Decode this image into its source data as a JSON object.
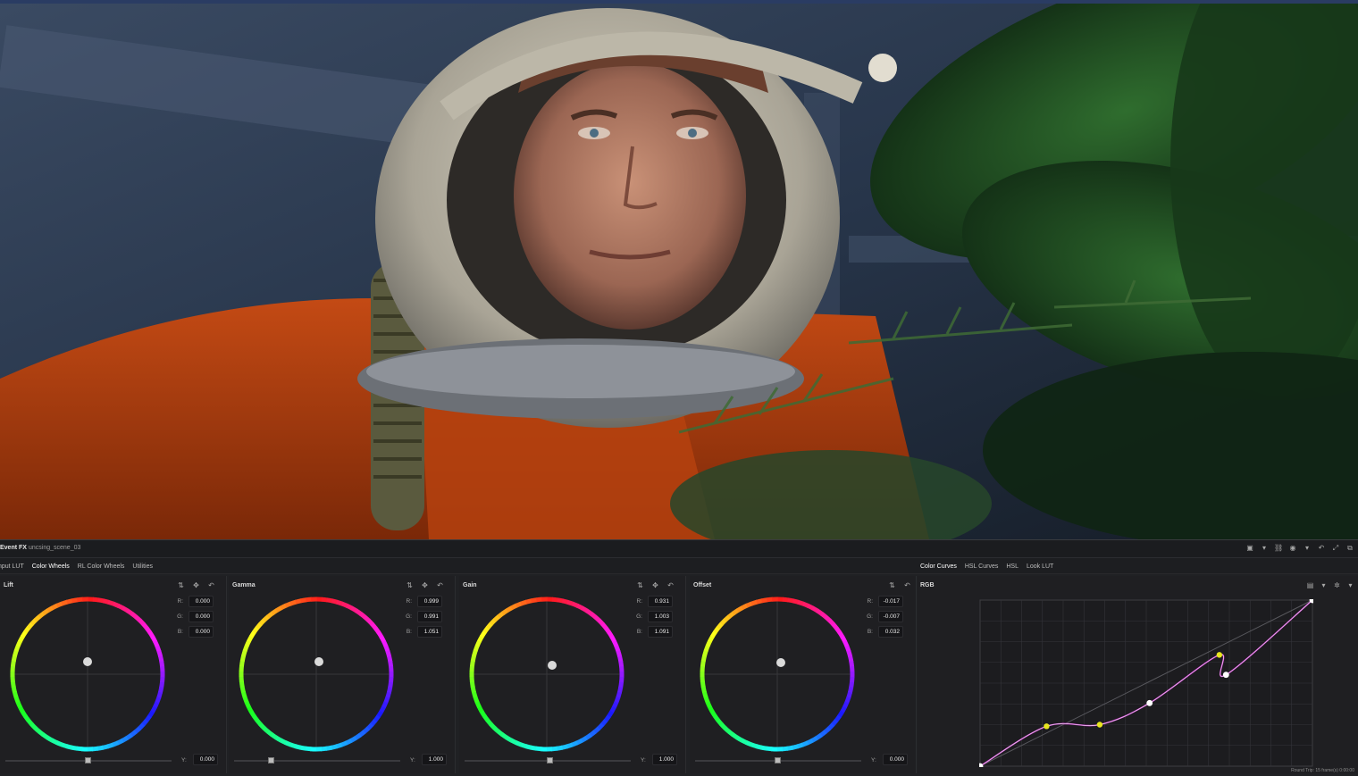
{
  "panel": {
    "title": "Event FX",
    "clip_name": "uncsing_scene_03",
    "footnote": "Round Trip: 15 frame(s) 0:00:00"
  },
  "tabs_left": [
    {
      "label": "Input LUT",
      "active": false
    },
    {
      "label": "Color Wheels",
      "active": true
    },
    {
      "label": "RL Color Wheels",
      "active": false
    },
    {
      "label": "Utilities",
      "active": false
    }
  ],
  "tabs_right": [
    {
      "label": "Color Curves",
      "active": true
    },
    {
      "label": "HSL Curves",
      "active": false
    },
    {
      "label": "HSL",
      "active": false
    },
    {
      "label": "Look LUT",
      "active": false
    }
  ],
  "wheels": [
    {
      "name": "Lift",
      "r": "0.000",
      "g": "0.000",
      "b": "0.000",
      "y": "0.000",
      "y_label": "Y:"
    },
    {
      "name": "Gamma",
      "r": "0.999",
      "g": "0.991",
      "b": "1.051",
      "y": "1.000",
      "y_label": "Y:"
    },
    {
      "name": "Gain",
      "r": "0.931",
      "g": "1.003",
      "b": "1.091",
      "y": "1.000",
      "y_label": "Y:"
    },
    {
      "name": "Offset",
      "r": "-0.017",
      "g": "-0.007",
      "b": "0.032",
      "y": "0.000",
      "y_label": "Y:"
    }
  ],
  "labels": {
    "r": "R:",
    "g": "G:",
    "b": "B:"
  },
  "curves": {
    "label": "RGB",
    "points_note": "yellow = channel points, white = master points",
    "master_points": [
      [
        0,
        0
      ],
      [
        0.51,
        0.38
      ],
      [
        0.74,
        0.55
      ],
      [
        1,
        1
      ]
    ],
    "channel_points": [
      [
        0.2,
        0.24
      ],
      [
        0.36,
        0.25
      ],
      [
        0.72,
        0.67
      ]
    ]
  },
  "colors": {
    "panel_bg": "#202124",
    "accent_curve": "#b318b8",
    "point_yellow": "#e8e51f"
  }
}
